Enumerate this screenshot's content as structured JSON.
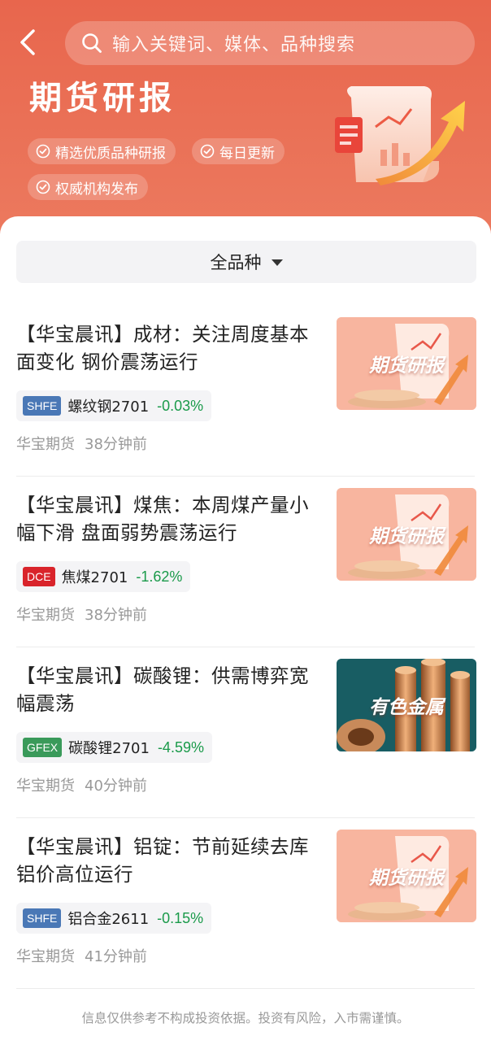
{
  "header": {
    "search_placeholder": "输入关键词、媒体、品种搜索",
    "title": "期货研报",
    "features": [
      "精选优质品种研报",
      "每日更新",
      "权威机构发布"
    ]
  },
  "filter": {
    "label": "全品种"
  },
  "news": [
    {
      "title": "【华宝晨讯】成材：关注周度基本面变化 钢价震荡运行",
      "exchange": "SHFE",
      "exchange_color": "#4a78b6",
      "contract": "螺纹钢2701",
      "change": "-0.03%",
      "source": "华宝期货",
      "time": "38分钟前",
      "thumb_label": "期货研报",
      "thumb_theme": "report"
    },
    {
      "title": "【华宝晨讯】煤焦：本周煤产量小幅下滑 盘面弱势震荡运行",
      "exchange": "DCE",
      "exchange_color": "#d9242b",
      "contract": "焦煤2701",
      "change": "-1.62%",
      "source": "华宝期货",
      "time": "38分钟前",
      "thumb_label": "期货研报",
      "thumb_theme": "report"
    },
    {
      "title": "【华宝晨讯】碳酸锂：供需博弈宽幅震荡",
      "exchange": "GFEX",
      "exchange_color": "#3a9a5a",
      "contract": "碳酸锂2701",
      "change": "-4.59%",
      "source": "华宝期货",
      "time": "40分钟前",
      "thumb_label": "有色金属",
      "thumb_theme": "metal"
    },
    {
      "title": "【华宝晨讯】铝锭：节前延续去库铝价高位运行",
      "exchange": "SHFE",
      "exchange_color": "#4a78b6",
      "contract": "铝合金2611",
      "change": "-0.15%",
      "source": "华宝期货",
      "time": "41分钟前",
      "thumb_label": "期货研报",
      "thumb_theme": "report"
    }
  ],
  "disclaimer": "信息仅供参考不构成投资依据。投资有风险，入市需谨慎。",
  "colors": {
    "brand": "#e8664d",
    "down": "#1a9a4a"
  }
}
